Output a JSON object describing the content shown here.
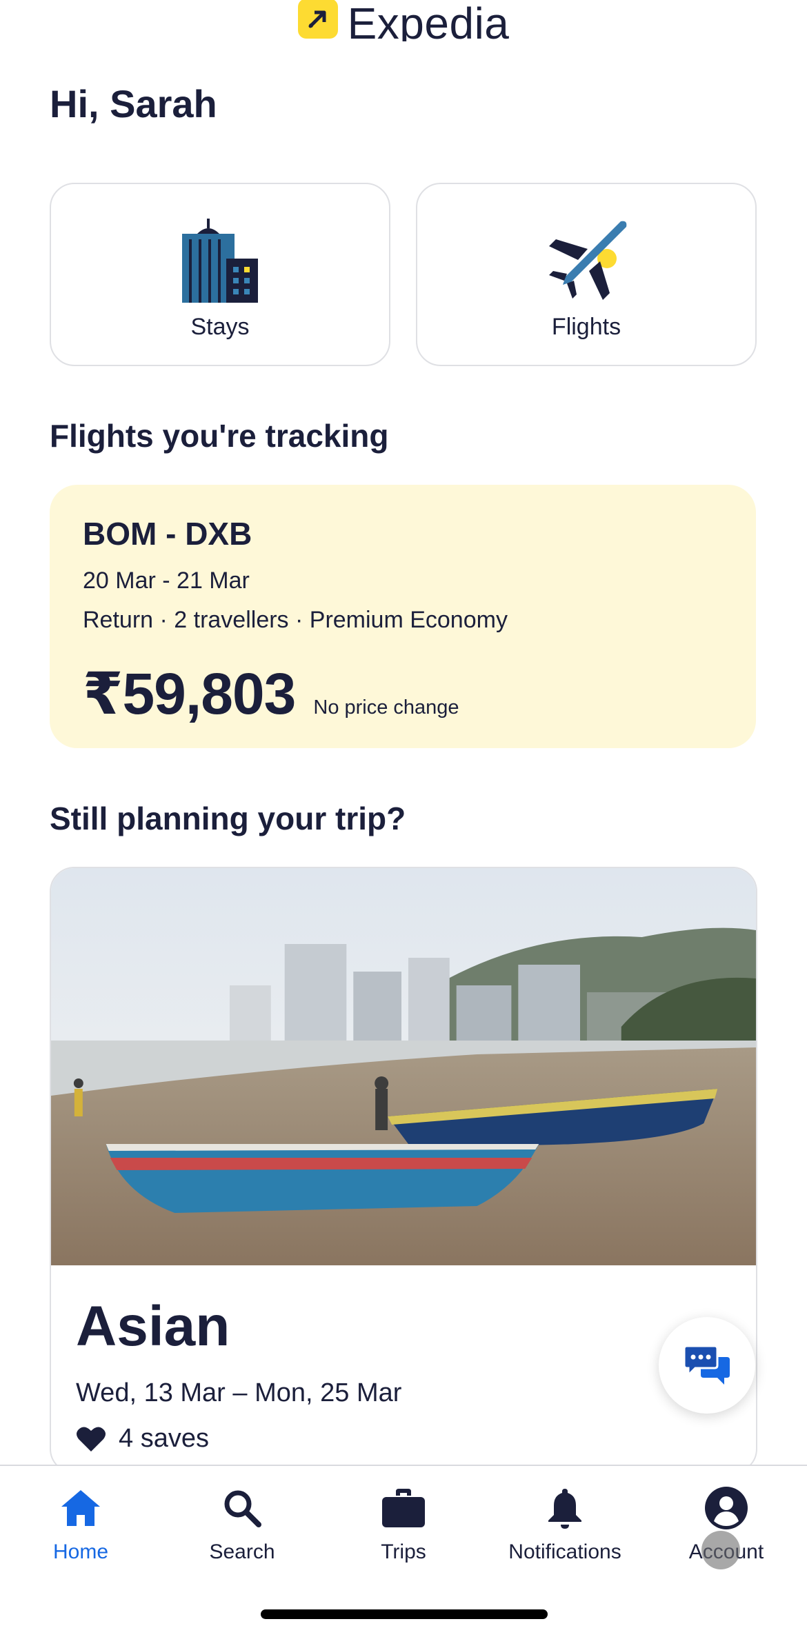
{
  "header": {
    "logo_text": "Expedia",
    "brand_color": "#fddb32"
  },
  "greeting": "Hi, Sarah",
  "quick_tiles": [
    {
      "label": "Stays",
      "icon": "building-icon"
    },
    {
      "label": "Flights",
      "icon": "airplane-icon"
    }
  ],
  "tracking": {
    "section_title": "Flights you're tracking",
    "route": "BOM - DXB",
    "dates": "20 Mar - 21 Mar",
    "details": "Return · 2 travellers · Premium Economy",
    "price": "₹59,803",
    "price_note": "No price change",
    "card_color": "#fef8d8"
  },
  "planning": {
    "section_title": "Still planning your trip?",
    "trip_name": "Asian",
    "trip_dates": "Wed, 13 Mar – Mon, 25 Mar",
    "saves": "4 saves",
    "image_desc_icon": "beach-photo"
  },
  "chat": {
    "icon": "chat-bubbles-icon",
    "color": "#1668e3"
  },
  "bottom_nav": [
    {
      "label": "Home",
      "icon": "home-icon",
      "active": true
    },
    {
      "label": "Search",
      "icon": "search-icon",
      "active": false
    },
    {
      "label": "Trips",
      "icon": "briefcase-icon",
      "active": false
    },
    {
      "label": "Notifications",
      "icon": "bell-icon",
      "active": false
    },
    {
      "label": "Account",
      "icon": "account-icon",
      "active": false
    }
  ],
  "colors": {
    "text": "#1b1f3b",
    "active": "#1668e3",
    "border": "#dfe0e4"
  }
}
